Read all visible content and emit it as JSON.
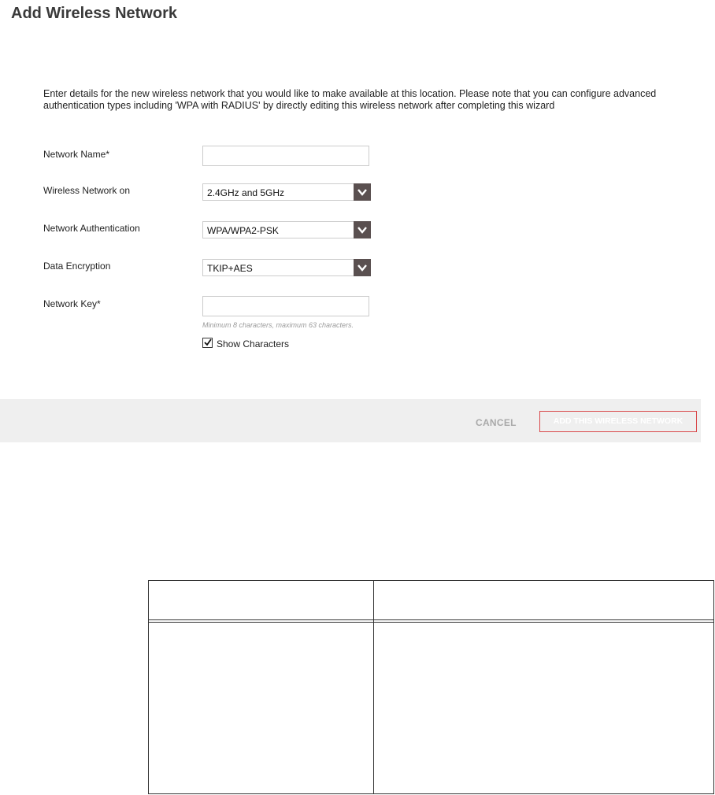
{
  "page": {
    "title": "Add Wireless Network",
    "intro": "Enter details for the new wireless network that you would like to make available at this location. Please note that you can configure advanced authentication types including 'WPA with RADIUS' by directly editing this wireless network after completing this wizard"
  },
  "form": {
    "network_name": {
      "label": "Network Name*",
      "value": ""
    },
    "wireless_network_on": {
      "label": "Wireless Network on",
      "value": "2.4GHz and 5GHz"
    },
    "network_authentication": {
      "label": "Network Authentication",
      "value": "WPA/WPA2-PSK"
    },
    "data_encryption": {
      "label": "Data Encryption",
      "value": "TKIP+AES"
    },
    "network_key": {
      "label": "Network Key*",
      "value": "",
      "hint": "Minimum 8 characters, maximum 63 characters."
    },
    "show_characters": {
      "label": "Show Characters",
      "checked": true
    }
  },
  "footer": {
    "cancel_label": "CANCEL",
    "add_label": "ADD THIS WIRELESS NETWORK"
  },
  "colors": {
    "select_arrow_bg": "#5a5050",
    "add_button_border": "#d9484a",
    "footer_bg": "#efefef"
  }
}
